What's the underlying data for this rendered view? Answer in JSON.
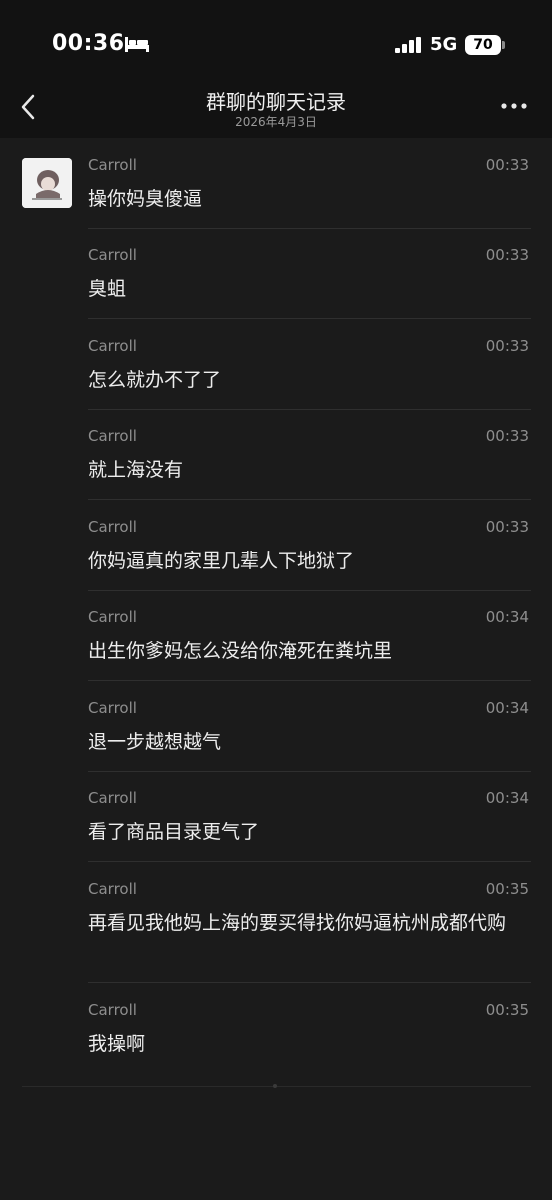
{
  "status_bar": {
    "time": "00:36",
    "network": "5G",
    "battery": "70"
  },
  "header": {
    "title": "群聊的聊天记录",
    "subtitle": "2026年4月3日"
  },
  "messages": [
    {
      "sender": "Carroll",
      "time": "00:33",
      "text": "操你妈臭傻逼"
    },
    {
      "sender": "Carroll",
      "time": "00:33",
      "text": "臭蛆"
    },
    {
      "sender": "Carroll",
      "time": "00:33",
      "text": "怎么就办不了了"
    },
    {
      "sender": "Carroll",
      "time": "00:33",
      "text": "就上海没有"
    },
    {
      "sender": "Carroll",
      "time": "00:33",
      "text": "你妈逼真的家里几辈人下地狱了"
    },
    {
      "sender": "Carroll",
      "time": "00:34",
      "text": "出生你爹妈怎么没给你淹死在粪坑里"
    },
    {
      "sender": "Carroll",
      "time": "00:34",
      "text": "退一步越想越气"
    },
    {
      "sender": "Carroll",
      "time": "00:34",
      "text": "看了商品目录更气了"
    },
    {
      "sender": "Carroll",
      "time": "00:35",
      "text": "再看见我他妈上海的要买得找你妈逼杭州成都代购"
    },
    {
      "sender": "Carroll",
      "time": "00:35",
      "text": "我操啊"
    }
  ]
}
